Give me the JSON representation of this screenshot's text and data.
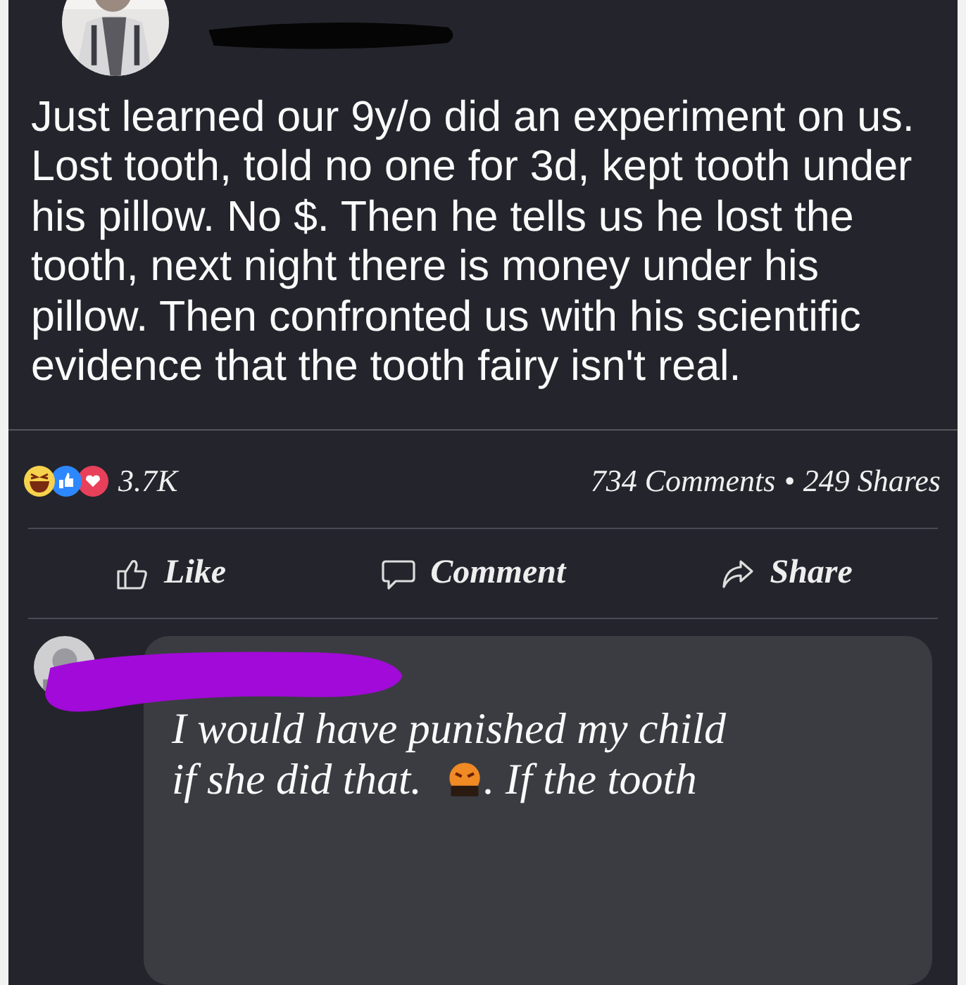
{
  "post": {
    "text": "Just learned our 9y/o did an experiment on us.  Lost tooth, told no one for 3d, kept tooth under his pillow.  No $.  Then he tells us he lost the tooth, next night there is money under his pillow.  Then confronted us with his scientific evidence that the tooth fairy isn't real."
  },
  "stats": {
    "reactions": "3.7K",
    "comments": "734 Comments",
    "separator": "•",
    "shares": "249 Shares"
  },
  "actions": [
    {
      "kind": "like",
      "label": "Like"
    },
    {
      "kind": "comment",
      "label": "Comment"
    },
    {
      "kind": "share",
      "label": "Share"
    }
  ],
  "comment": {
    "line_1": "I would have punished my child",
    "line_2_before": "if she did that.",
    "line_2_after": ". If the tooth"
  }
}
